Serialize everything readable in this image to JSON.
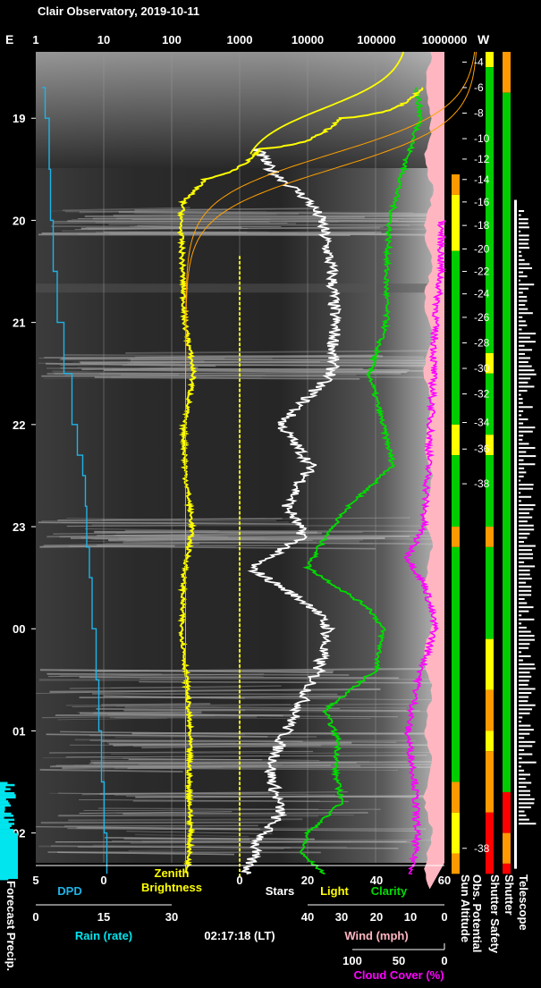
{
  "title": "Clair Observatory, 2019-10-11",
  "timestamp": "02:17:18 (LT)",
  "colors": {
    "background": "#000000",
    "dpd": "#1fb3e6",
    "rain": "#00e5ee",
    "zenith": "#ffff00",
    "sky_curve": "#ffa000",
    "stars": "#ffffff",
    "light": "#ffff00",
    "clarity": "#00dd00",
    "wind": "#ffb6c1",
    "cloud_cover": "#ff00ff",
    "green": "#00cc00",
    "yellow": "#ffff00",
    "orange": "#ff9900",
    "red": "#ff0000"
  },
  "chart_data": {
    "type": "line",
    "title": "Clair Observatory, 2019-10-11",
    "top_axis": {
      "left_label": "E",
      "right_label": "W",
      "scale": "log",
      "ticks": [
        "1",
        "10",
        "100",
        "1000",
        "10000",
        "100000",
        "1000000"
      ]
    },
    "time_axis": {
      "ticks": [
        "19",
        "20",
        "21",
        "22",
        "23",
        "00",
        "01",
        "02"
      ]
    },
    "sun_altitude_ticks": [
      "-4",
      "-6",
      "-8",
      "-10",
      "-12",
      "-14",
      "-16",
      "-18",
      "-20",
      "-22",
      "-24",
      "-26",
      "-28",
      "-30",
      "-32",
      "-34",
      "-36",
      "-38",
      "-38"
    ],
    "bottom_axes": {
      "dpd": {
        "label": "DPD",
        "ticks": [
          "5",
          "0"
        ]
      },
      "zenith": {
        "label_line1": "Zenith",
        "label_line2": "Brightness"
      },
      "stars_light_clarity": {
        "ticks": [
          "0",
          "20",
          "40",
          "60"
        ],
        "labels": [
          "Stars",
          "Light",
          "Clarity"
        ]
      },
      "rain": {
        "label": "Rain (rate)",
        "ticks": [
          "0",
          "15",
          "30"
        ]
      },
      "wind": {
        "label": "Wind (mph)",
        "ticks": [
          "40",
          "30",
          "20",
          "10",
          "0"
        ]
      },
      "cloud_cover": {
        "label": "Cloud Cover (%)",
        "ticks": [
          "100",
          "50",
          "0"
        ]
      }
    },
    "series": [
      {
        "name": "DPD",
        "color": "#1fb3e6",
        "x": [
          18.7,
          19.0,
          19.5,
          20.0,
          20.5,
          21.0,
          21.5,
          22.0,
          22.3,
          22.5,
          22.8,
          23.2,
          23.5,
          24.0,
          24.5,
          25.0,
          25.5,
          26.0,
          26.4
        ],
        "y": [
          4.5,
          4.3,
          4.0,
          3.9,
          3.7,
          3.4,
          2.9,
          2.3,
          1.9,
          1.5,
          1.3,
          1.2,
          1.0,
          0.8,
          0.5,
          0.3,
          0.1,
          -0.1,
          -0.3
        ]
      },
      {
        "name": "Zenith Brightness",
        "color": "#ffff00",
        "x": [
          18.7,
          19.0,
          19.3,
          19.6,
          19.8,
          20.0,
          20.5,
          21.0,
          21.5,
          22.0,
          22.5,
          23.0,
          23.5,
          24.0,
          24.5,
          25.0,
          25.5,
          26.0,
          26.4
        ],
        "y": [
          500000,
          30000,
          2000,
          300,
          150,
          135,
          145,
          155,
          210,
          150,
          160,
          200,
          150,
          140,
          165,
          185,
          180,
          190,
          170
        ]
      },
      {
        "name": "Stars",
        "color": "#ffffff",
        "x": [
          19.3,
          19.5,
          19.8,
          20.0,
          20.5,
          21.0,
          21.5,
          22.0,
          22.4,
          22.8,
          23.1,
          23.4,
          23.8,
          24.0,
          24.4,
          24.8,
          25.1,
          25.4,
          25.8,
          26.1,
          26.4
        ],
        "y": [
          5,
          9,
          20,
          24,
          27,
          28,
          27,
          12,
          21,
          14,
          19,
          3,
          22,
          26,
          23,
          17,
          12,
          9,
          12,
          5,
          2
        ]
      },
      {
        "name": "Clarity",
        "color": "#00dd00",
        "x": [
          18.7,
          19.0,
          19.5,
          20.0,
          20.5,
          21.0,
          21.5,
          22.0,
          22.4,
          22.8,
          23.1,
          23.4,
          23.8,
          24.0,
          24.4,
          24.8,
          25.1,
          25.4,
          25.7,
          26.0,
          26.2,
          26.4
        ],
        "y": [
          52,
          53,
          48,
          44,
          43,
          43,
          38,
          42,
          45,
          32,
          25,
          20,
          38,
          42,
          40,
          25,
          29,
          28,
          30,
          20,
          18,
          25
        ]
      },
      {
        "name": "Cloud Cover",
        "color": "#ff00ff",
        "x": [
          20.0,
          20.5,
          21.0,
          21.5,
          22.0,
          22.5,
          23.0,
          23.3,
          23.6,
          24.0,
          24.5,
          25.0,
          25.5,
          26.0,
          26.4
        ],
        "y": [
          3,
          4,
          10,
          12,
          15,
          18,
          23,
          40,
          20,
          10,
          28,
          40,
          32,
          30,
          35
        ]
      }
    ],
    "status_bars": [
      "Sun Altitude",
      "Obs. Potential",
      "Shutter Safety",
      "Shutter",
      "Telescope"
    ],
    "forecast": {
      "label": "Forecast Precip.",
      "start_hour": 25.5
    }
  }
}
